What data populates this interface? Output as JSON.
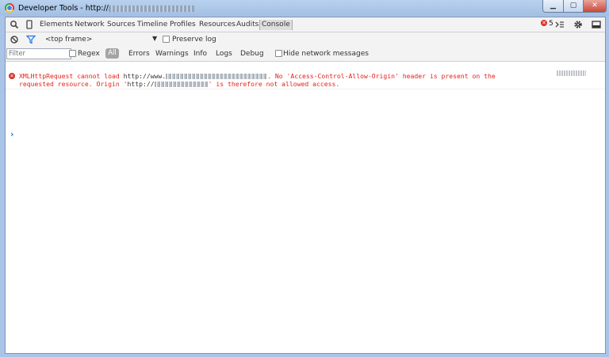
{
  "window": {
    "title_prefix": "Developer Tools - http://",
    "controls": {
      "minimize": "▁",
      "maximize": "▢",
      "close": "✕"
    }
  },
  "toolbar": {
    "tabs": [
      "Elements",
      "Network",
      "Sources",
      "Timeline",
      "Profiles",
      "Resources",
      "Audits",
      "Console"
    ],
    "active_tab": "Console",
    "error_count": "5",
    "error_badge": "✕"
  },
  "console_bar": {
    "context": "<top frame>",
    "context_arrow": "▼",
    "preserve_log": "Preserve log"
  },
  "filter_bar": {
    "filter_placeholder": "Filter",
    "regex": "Regex",
    "levels": [
      "All",
      "Errors",
      "Warnings",
      "Info",
      "Logs",
      "Debug"
    ],
    "hide_network": "Hide network messages"
  },
  "messages": [
    {
      "level": "error",
      "icon": "✕",
      "line1_a": "XMLHttpRequest cannot load ",
      "line1_url": "http://www.",
      "line1_b": ". No 'Access-Control-Allow-Origin' header is present on the",
      "line2_a": "requested resource. Origin '",
      "line2_url": "http://",
      "line2_b": "' is therefore not allowed access."
    }
  ],
  "prompt": "›",
  "colors": {
    "error": "#e2231a",
    "prompt": "#1a73e8",
    "filter_icon": "#1a73e8"
  }
}
